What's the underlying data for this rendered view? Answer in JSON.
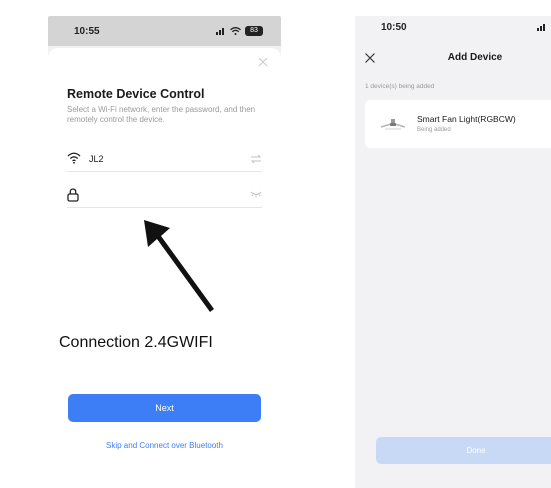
{
  "left_screen": {
    "status_time": "10:55",
    "battery": "83",
    "title": "Remote Device Control",
    "subtitle": "Select a Wi-Fi network, enter the password, and then remotely control the device.",
    "wifi_name": "JL2",
    "password_value": "",
    "caption": "Connection 2.4GWIFI",
    "next_label": "Next",
    "skip_label": "Skip and Connect over Bluetooth",
    "icons": [
      "close-icon",
      "wifi-icon",
      "switch-icon",
      "lock-icon",
      "eye-hidden-icon",
      "arrow-annotation"
    ],
    "accent_color": "#3d7ef7"
  },
  "right_screen": {
    "status_time": "10:50",
    "nav_title": "Add Device",
    "section_label": "1 device(s) being added",
    "device_name": "Smart Fan Light(RGBCW)",
    "device_status": "Being added",
    "done_label": "Done",
    "icons": [
      "close-icon",
      "fan-light-icon"
    ],
    "disabled_button_color": "#c8d9f6"
  }
}
